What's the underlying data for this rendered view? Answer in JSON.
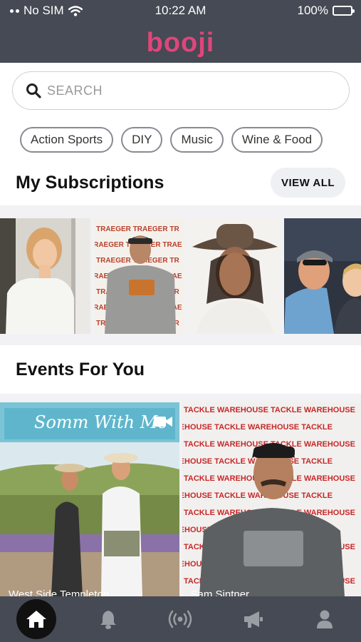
{
  "status": {
    "carrier": "No SIM",
    "time": "10:22 AM",
    "battery": "100%"
  },
  "app": {
    "logo": "booji"
  },
  "search": {
    "placeholder": "SEARCH"
  },
  "categories": [
    "Action Sports",
    "DIY",
    "Music",
    "Wine & Food"
  ],
  "subscriptions": {
    "title": "My Subscriptions",
    "view_all": "VIEW ALL"
  },
  "events": {
    "title": "Events For You",
    "cards": [
      {
        "banner": "Somm With Me",
        "label": "West Side Templeton"
      },
      {
        "label": "Sam Sintner"
      }
    ]
  },
  "thumb_text": {
    "traeger": "TRAEGER",
    "tackle": "TACKLE WAREHOUSE"
  },
  "tabs": [
    "home",
    "notifications",
    "live",
    "announcements",
    "profile"
  ],
  "colors": {
    "header": "#454a54",
    "brand": "#e0457b",
    "battery": "#4cd964"
  }
}
